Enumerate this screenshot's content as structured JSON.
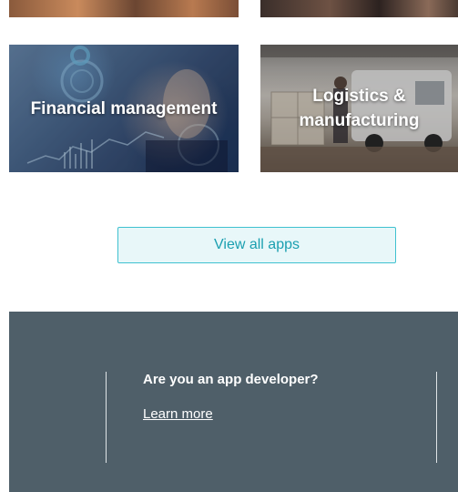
{
  "tiles": [
    {
      "label": "Financial management",
      "image": "financial-chart-touchscreen"
    },
    {
      "label": "Logistics & manufacturing",
      "image": "warehouse-van-boxes"
    }
  ],
  "view_all_button": {
    "label": "View all apps"
  },
  "developer_banner": {
    "title": "Are you an app developer?",
    "link_label": "Learn more"
  },
  "colors": {
    "accent": "#3fc1d0",
    "button_bg": "#e8f7f9",
    "button_text": "#1a9fb0",
    "banner_bg": "#4f5f69",
    "banner_text": "#ffffff"
  }
}
